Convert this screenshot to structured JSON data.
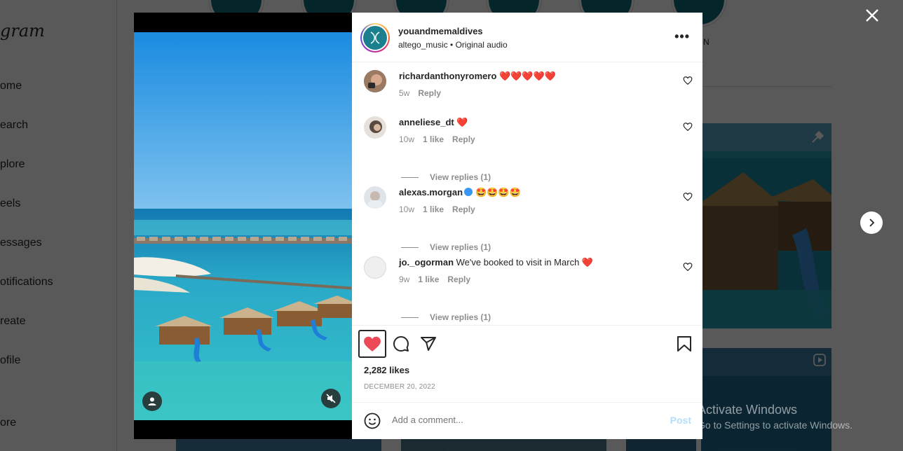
{
  "background": {
    "logo": "gram",
    "nav": [
      "ome",
      "earch",
      "plore",
      "eels",
      "essages",
      "otifications",
      "reate",
      "ofile",
      "ore"
    ],
    "highlight_label": "N"
  },
  "post": {
    "username": "youandmemaldives",
    "audio": "altego_music • Original audio",
    "more_icon": "•••",
    "likes": "2,282 likes",
    "date": "DECEMBER 20, 2022",
    "comment_placeholder": "Add a comment...",
    "post_label": "Post"
  },
  "comments": [
    {
      "user": "richardanthonyromero",
      "text": "❤️❤️❤️❤️❤️",
      "age": "5w",
      "likes": "",
      "reply": "Reply",
      "view_replies": ""
    },
    {
      "user": "anneliese_dt",
      "text": "❤️",
      "age": "10w",
      "likes": "1 like",
      "reply": "Reply",
      "view_replies": "View replies (1)"
    },
    {
      "user": "alexas.morgan",
      "text": "🤩🤩🤩🤩",
      "age": "10w",
      "likes": "1 like",
      "reply": "Reply",
      "view_replies": "View replies (1)",
      "verified": true
    },
    {
      "user": "jo._ogorman",
      "text": "We've booked to visit in March ❤️",
      "age": "9w",
      "likes": "1 like",
      "reply": "Reply",
      "view_replies": "View replies (1)"
    }
  ],
  "watermark": {
    "line1": "Activate Windows",
    "line2": "Go to Settings to activate Windows."
  },
  "colors": {
    "like_red": "#ed4956",
    "teal": "#0e6a78",
    "post_disabled": "#b2dffc"
  }
}
